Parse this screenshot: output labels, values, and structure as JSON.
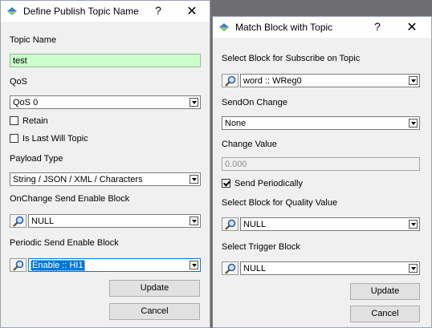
{
  "dialog_left": {
    "title": "Define Publish Topic Name",
    "help": "?",
    "close": "✕",
    "topic_name_label": "Topic Name",
    "topic_name_value": "test",
    "qos_label": "QoS",
    "qos_value": "QoS 0",
    "retain_label": "Retain",
    "retain_checked": false,
    "last_will_label": "Is Last Will Topic",
    "last_will_checked": false,
    "payload_type_label": "Payload Type",
    "payload_type_value": "String / JSON / XML / Characters",
    "onchange_label": "OnChange Send Enable Block",
    "onchange_value": "NULL",
    "periodic_label": "Periodic Send Enable Block",
    "periodic_value": "Enable :: HI1",
    "update_label": "Update",
    "cancel_label": "Cancel"
  },
  "dialog_right": {
    "title": "Match Block with Topic",
    "help": "?",
    "close": "✕",
    "select_block_label": "Select Block for Subscribe on Topic",
    "select_block_value": "word :: WReg0",
    "sendon_label": "SendOn Change",
    "sendon_value": "None",
    "change_value_label": "Change Value",
    "change_value_placeholder": "0.000",
    "send_periodically_label": "Send Periodically",
    "send_periodically_checked": true,
    "quality_label": "Select Block for Quality Value",
    "quality_value": "NULL",
    "trigger_label": "Select Trigger Block",
    "trigger_value": "NULL",
    "update_label": "Update",
    "cancel_label": "Cancel"
  },
  "colors": {
    "topic_field_bg": "#ccffcc",
    "selection_bg": "#0078d7"
  }
}
